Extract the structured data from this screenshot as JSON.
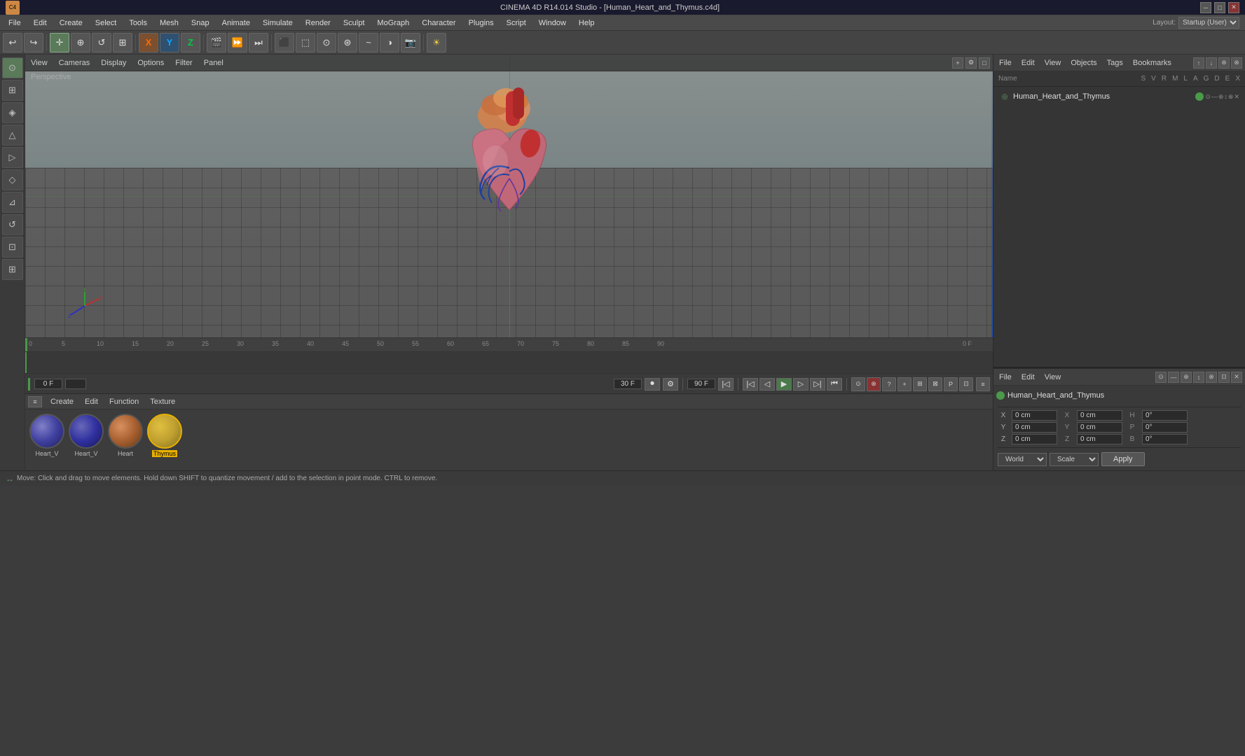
{
  "titlebar": {
    "title": "CINEMA 4D R14.014 Studio - [Human_Heart_and_Thymus.c4d]",
    "min_btn": "─",
    "max_btn": "□",
    "close_btn": "✕"
  },
  "menubar": {
    "items": [
      "File",
      "Edit",
      "Create",
      "Select",
      "Tools",
      "Mesh",
      "Snap",
      "Animate",
      "Simulate",
      "Render",
      "Sculpt",
      "MoGraph",
      "Character",
      "Plugins",
      "Script",
      "Window",
      "Help"
    ]
  },
  "toolbar": {
    "undo_icon": "↩",
    "redo_icon": "↪",
    "layout_label": "Layout:",
    "layout_value": "Startup (User)"
  },
  "left_tools": {
    "icons": [
      "⊙",
      "⊞",
      "◈",
      "△",
      "▷",
      "◇",
      "⊿",
      "↺",
      "⊡",
      "⊞"
    ]
  },
  "viewport": {
    "menus": [
      "View",
      "Cameras",
      "Display",
      "Options",
      "Filter",
      "Panel"
    ],
    "label": "Perspective",
    "controls": [
      "+",
      "-",
      "□"
    ]
  },
  "timeline": {
    "current_frame": "0 F",
    "frame_rate": "30 F",
    "end_frame": "90 F",
    "frame_marks": [
      "0",
      "5",
      "10",
      "15",
      "20",
      "25",
      "30",
      "35",
      "40",
      "45",
      "50",
      "55",
      "60",
      "65",
      "70",
      "75",
      "80",
      "85",
      "90"
    ],
    "right_frame": "0 F"
  },
  "material_area": {
    "menus": [
      "Create",
      "Edit",
      "Function",
      "Texture"
    ],
    "materials": [
      {
        "name": "Heart_V",
        "color": "#6a6aa0",
        "selected": false
      },
      {
        "name": "Heart_V",
        "color": "#5050a0",
        "selected": false
      },
      {
        "name": "Heart",
        "color": "#b87040",
        "selected": false
      },
      {
        "name": "Thymus",
        "color": "#c0a030",
        "selected": true
      }
    ]
  },
  "right_panel": {
    "object_manager": {
      "menus": [
        "File",
        "Edit",
        "View",
        "Objects",
        "Tags",
        "Bookmarks"
      ],
      "columns": [
        "Name",
        "S",
        "V",
        "R",
        "M",
        "L",
        "A",
        "G",
        "D",
        "E",
        "X"
      ],
      "objects": [
        {
          "name": "Human_Heart_and_Thymus",
          "dot_color": "#4a9a4a",
          "icon": "◎"
        }
      ]
    },
    "layout": {
      "label": "Layout:",
      "value": "Startup (User)"
    },
    "attributes": {
      "menus": [
        "File",
        "Edit",
        "View"
      ],
      "object_name": "Human_Heart_and_Thymus",
      "object_dot": "#4a9a4a",
      "coordinates": {
        "x_pos": "0 cm",
        "y_pos": "0 cm",
        "z_pos": "0 cm",
        "x_rot": "0°",
        "y_rot": "0°",
        "z_rot": "0°",
        "x_scale": "0 cm",
        "y_scale": "0 cm",
        "z_scale": "0 cm",
        "h": "0°",
        "p": "0°",
        "b": "0°"
      },
      "coord_labels": {
        "x": "X",
        "y": "Y",
        "z": "Z",
        "h": "H",
        "p": "P",
        "b": "B"
      },
      "dropdowns": {
        "space": "World",
        "mode": "Scale"
      },
      "apply_btn": "Apply"
    }
  },
  "statusbar": {
    "icon": "↔",
    "text": "Move: Click and drag to move elements. Hold down SHIFT to quantize movement / add to the selection in point mode. CTRL to remove."
  }
}
